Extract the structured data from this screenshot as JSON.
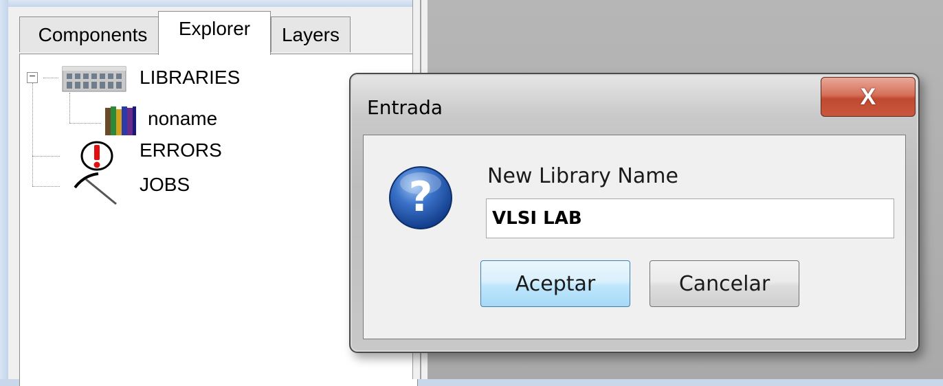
{
  "tabs": [
    {
      "label": "Components",
      "active": false
    },
    {
      "label": "Explorer",
      "active": true
    },
    {
      "label": "Layers",
      "active": false
    }
  ],
  "tree": {
    "libraries": {
      "label": "LIBRARIES",
      "icon": "library-building-icon",
      "expanded": true
    },
    "library_noname": {
      "label": "noname",
      "icon": "books-icon"
    },
    "errors": {
      "label": "ERRORS",
      "icon": "error-icon"
    },
    "jobs": {
      "label": "JOBS",
      "icon": "pickaxe-icon"
    }
  },
  "dialog": {
    "title": "Entrada",
    "close_label": "X",
    "icon": "question-icon",
    "prompt": "New Library Name",
    "input_value": "VLSI LAB",
    "accept_label": "Aceptar",
    "cancel_label": "Cancelar"
  },
  "colors": {
    "accept_button_border": "#3c7fb1",
    "close_button": "#c04a30",
    "question_icon": "#2a5db0"
  }
}
